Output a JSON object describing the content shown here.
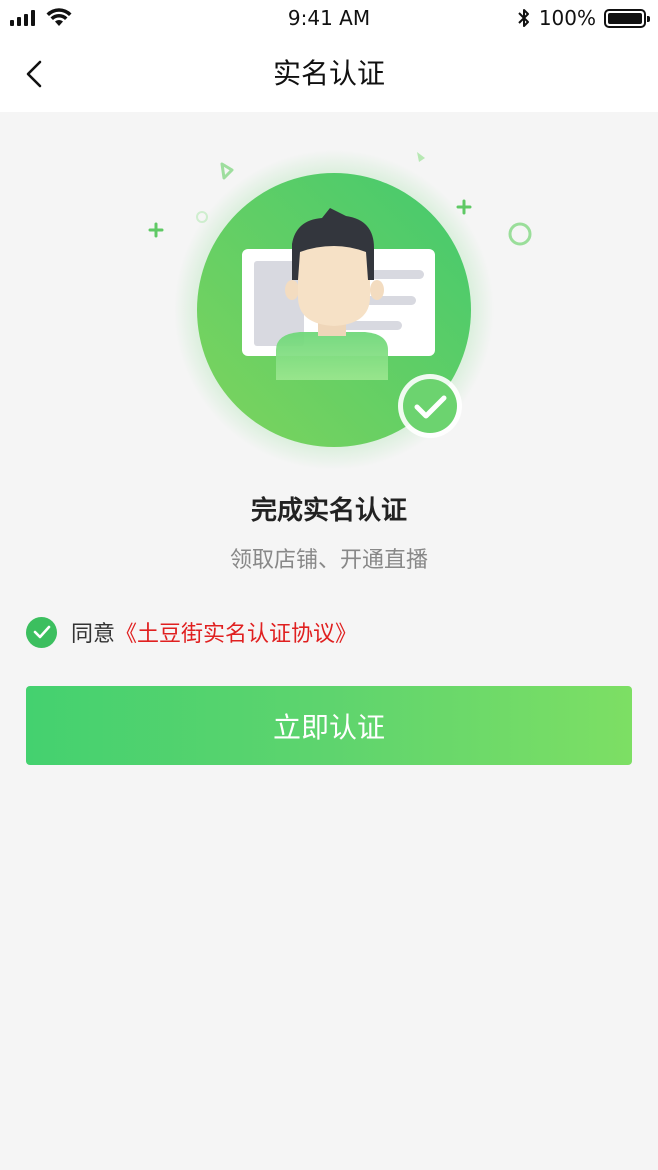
{
  "status_bar": {
    "time": "9:41 AM",
    "battery": "100%"
  },
  "nav": {
    "title": "实名认证",
    "back_icon": "chevron-left-icon"
  },
  "hero": {
    "illustration": "id-card-verified-icon"
  },
  "content": {
    "title": "完成实名认证",
    "subtitle": "领取店铺、开通直播"
  },
  "agreement": {
    "checked": true,
    "prefix": "同意",
    "link": "《土豆街实名认证协议》"
  },
  "actions": {
    "primary": "立即认证"
  },
  "colors": {
    "accent": "#3cbf5f",
    "link": "#e02020",
    "background": "#f5f5f5"
  }
}
